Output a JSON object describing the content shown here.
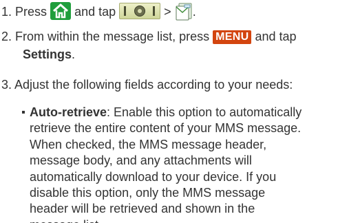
{
  "steps": [
    {
      "number": "1.",
      "text_press": "Press",
      "text_and_tap": "and tap",
      "text_gt": ">",
      "text_end": ".",
      "home_icon": "home-key-icon",
      "apps_icon": "applications-tab-icon",
      "messaging_icon": "messaging-app-icon"
    },
    {
      "number": "2.",
      "text_before": "From within the message list, press",
      "menu_key": "MENU",
      "text_after": "and tap",
      "settings_label": "Settings",
      "text_end": "."
    },
    {
      "number": "3.",
      "text": "Adjust the following fields according to your needs:"
    }
  ],
  "bullet": {
    "term": "Auto-retrieve",
    "lines": [
      ": Enable this option to automatically",
      "retrieve the entire content of your MMS message.",
      "When checked, the MMS message header,",
      "message body, and any attachments will",
      "automatically download to your device. If you",
      "disable this option, only the MMS message",
      "header will be retrieved and shown in the",
      "message list."
    ]
  },
  "colors": {
    "text": "#333333",
    "menu_key_bg": "#d3450f",
    "home_key_bg": "#1f9e3c"
  }
}
